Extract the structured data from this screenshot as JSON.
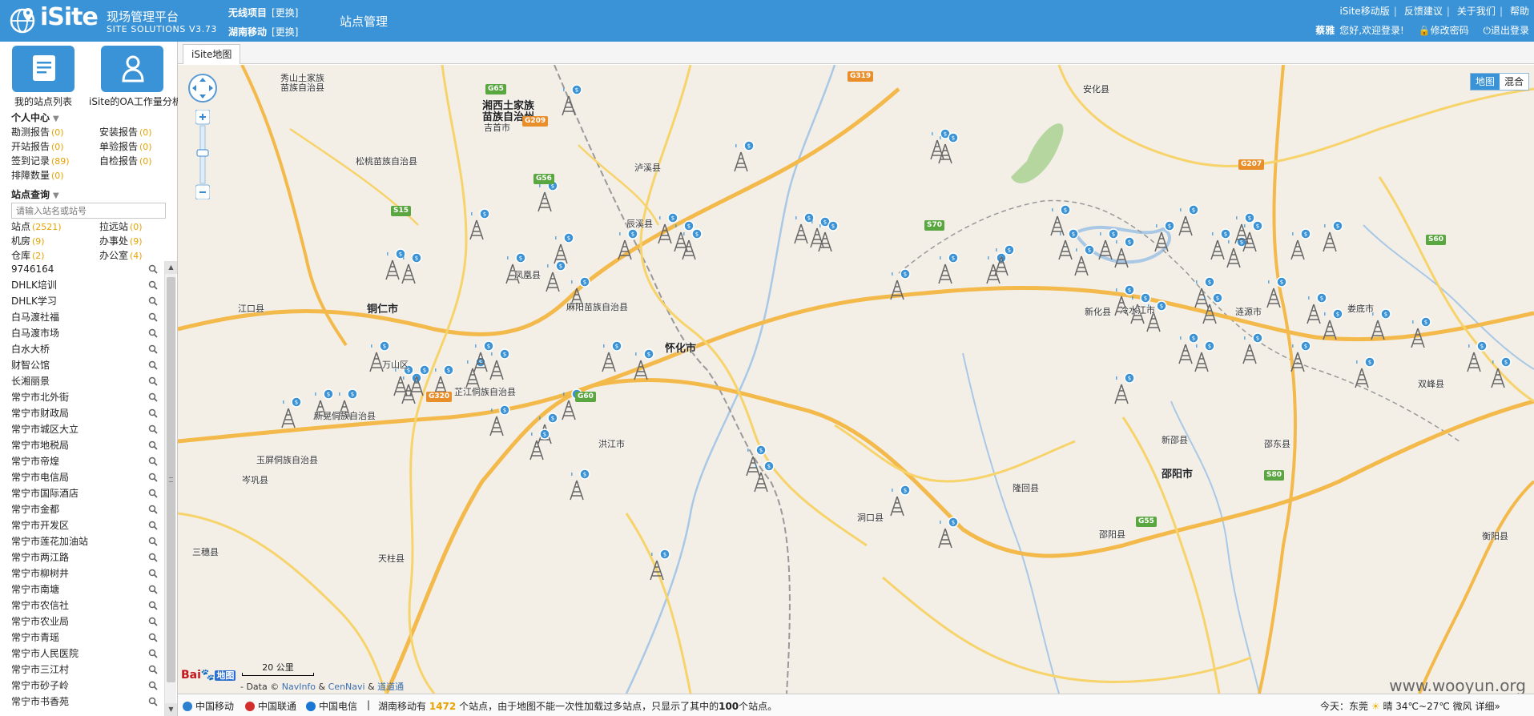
{
  "header": {
    "brand": "iSite",
    "brand_cn": "现场管理平台",
    "brand_sub": "SITE SOLUTIONS V3.73",
    "project_label": "无线项目",
    "project_change": "[更换]",
    "company_label": "湖南移动",
    "company_change": "[更换]",
    "module_title": "站点管理",
    "links": [
      "iSite移动版",
      "反馈建议",
      "关于我们",
      "帮助"
    ],
    "user_name": "蔡雅",
    "welcome": "您好,欢迎登录!",
    "change_password": "修改密码",
    "logout": "退出登录"
  },
  "sidebar": {
    "big_buttons": [
      {
        "label": "我的站点列表",
        "icon": "document-list-icon"
      },
      {
        "label": "iSite的OA工作量分析",
        "icon": "person-icon"
      }
    ],
    "personal_center": {
      "title": "个人中心",
      "items": [
        {
          "label": "勘测报告",
          "count": "(0)"
        },
        {
          "label": "安装报告",
          "count": "(0)"
        },
        {
          "label": "开站报告",
          "count": "(0)"
        },
        {
          "label": "单验报告",
          "count": "(0)"
        },
        {
          "label": "签到记录",
          "count": "(89)"
        },
        {
          "label": "自检报告",
          "count": "(0)"
        },
        {
          "label": "排障数量",
          "count": "(0)"
        }
      ]
    },
    "site_query": {
      "title": "站点查询",
      "placeholder": "请输入站名或站号",
      "items": [
        {
          "label": "站点",
          "count": "(2521)"
        },
        {
          "label": "拉远站",
          "count": "(0)"
        },
        {
          "label": "机房",
          "count": "(9)"
        },
        {
          "label": "办事处",
          "count": "(9)"
        },
        {
          "label": "仓库",
          "count": "(2)"
        },
        {
          "label": "办公室",
          "count": "(4)"
        }
      ]
    },
    "site_list": [
      "9746164",
      "DHLK培训",
      "DHLK学习",
      "白马渡社福",
      "白马渡市场",
      "白水大桥",
      "财智公馆",
      "长湘丽景",
      "常宁市北外街",
      "常宁市财政局",
      "常宁市城区大立",
      "常宁市地税局",
      "常宁市帝煌",
      "常宁市电信局",
      "常宁市国际酒店",
      "常宁市金都",
      "常宁市开发区",
      "常宁市莲花加油站",
      "常宁市两江路",
      "常宁市柳树井",
      "常宁市南塘",
      "常宁市农信社",
      "常宁市农业局",
      "常宁市青瑶",
      "常宁市人民医院",
      "常宁市三江村",
      "常宁市砂子岭",
      "常宁市书香苑"
    ]
  },
  "map": {
    "tab": "iSite地图",
    "type_map": "地图",
    "type_hybrid": "混合",
    "scale": "20 公里",
    "baidu_logo": "Bai",
    "baidu_map": "地图",
    "copyright_prefix": "- Data ©",
    "provider1": "NavInfo",
    "and": "&",
    "provider2": "CenNavi",
    "and2": "&",
    "provider3": "道道通",
    "watermark": "www.wooyun.org",
    "places": [
      {
        "name": "湘西土家族",
        "kind": "city"
      },
      {
        "name": "苗族自治州",
        "kind": "city"
      },
      {
        "name": "铜仁市",
        "kind": "city"
      },
      {
        "name": "怀化市",
        "kind": "city"
      },
      {
        "name": "邵阳市",
        "kind": "city"
      },
      {
        "name": "秀山土家族",
        "kind": "town"
      },
      {
        "name": "苗族自治县",
        "kind": "town"
      },
      {
        "name": "吉首市",
        "kind": "town"
      },
      {
        "name": "泸溪县",
        "kind": "town"
      },
      {
        "name": "安化县",
        "kind": "town"
      },
      {
        "name": "松桃苗族自治县",
        "kind": "town"
      },
      {
        "name": "辰溪县",
        "kind": "town"
      },
      {
        "name": "凤凰县",
        "kind": "town"
      },
      {
        "name": "麻阳苗族自治县",
        "kind": "town"
      },
      {
        "name": "江口县",
        "kind": "town"
      },
      {
        "name": "万山区",
        "kind": "town"
      },
      {
        "name": "芷江侗族自治县",
        "kind": "town"
      },
      {
        "name": "新晃侗族自治县",
        "kind": "town"
      },
      {
        "name": "玉屏侗族自治县",
        "kind": "town"
      },
      {
        "name": "岑巩县",
        "kind": "town"
      },
      {
        "name": "洪江市",
        "kind": "town"
      },
      {
        "name": "洞口县",
        "kind": "town"
      },
      {
        "name": "隆回县",
        "kind": "town"
      },
      {
        "name": "新邵县",
        "kind": "town"
      },
      {
        "name": "邵东县",
        "kind": "town"
      },
      {
        "name": "涟源市",
        "kind": "town"
      },
      {
        "name": "娄底市",
        "kind": "town"
      },
      {
        "name": "冷水江市",
        "kind": "town"
      },
      {
        "name": "双峰县",
        "kind": "town"
      },
      {
        "name": "邵阳县",
        "kind": "town"
      },
      {
        "name": "衡阳县",
        "kind": "town"
      },
      {
        "name": "三穗县",
        "kind": "town"
      },
      {
        "name": "天柱县",
        "kind": "town"
      },
      {
        "name": "新化县",
        "kind": "town"
      }
    ],
    "road_shields": [
      {
        "code": "G319",
        "color": "r"
      },
      {
        "code": "G65",
        "color": "g"
      },
      {
        "code": "G209",
        "color": "r"
      },
      {
        "code": "G56",
        "color": "g"
      },
      {
        "code": "S15",
        "color": "g"
      },
      {
        "code": "S70",
        "color": "g"
      },
      {
        "code": "G60",
        "color": "g"
      },
      {
        "code": "G320",
        "color": "r"
      },
      {
        "code": "S60",
        "color": "g"
      },
      {
        "code": "G207",
        "color": "r"
      },
      {
        "code": "S80",
        "color": "g"
      },
      {
        "code": "G55",
        "color": "g"
      }
    ]
  },
  "status": {
    "op1": "中国移动",
    "op2": "中国联通",
    "op3": "中国电信",
    "msg_prefix": "湖南移动有",
    "total": "1472",
    "msg_mid": "个站点，由于地图不能一次性加载过多站点，只显示了其中的",
    "shown": "100",
    "msg_suffix": "个站点。",
    "weather_label": "今天：",
    "weather_place": "东莞",
    "weather_desc": "晴 34℃~27℃ 微风 详细»"
  },
  "colors": {
    "header_blue": "#3a93d6",
    "count_orange": "#e8a200",
    "map_bg": "#f3efe7",
    "road_orange": "#f3b94b",
    "road_yellow": "#f7d36b",
    "water": "#a9c8e6"
  }
}
